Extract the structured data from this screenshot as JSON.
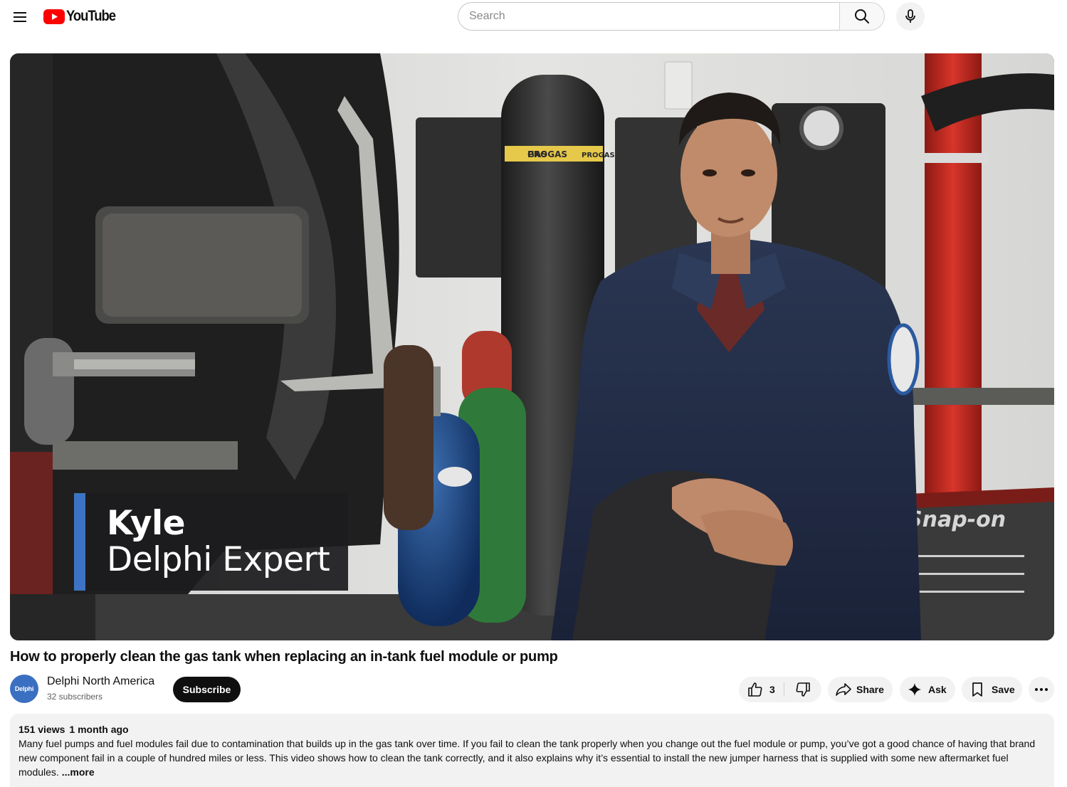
{
  "header": {
    "logo_text": "YouTube",
    "search_placeholder": "Search",
    "icons": [
      "menu-icon",
      "youtube-logo-icon",
      "search-icon",
      "microphone-icon"
    ]
  },
  "video": {
    "overlay_name": "Kyle",
    "overlay_role": "Delphi Expert",
    "scene_text": {
      "cylinder_label": "PROGAS",
      "cylinder_label_left": "GAS",
      "cylinder_label_right": "PROGAS",
      "machine_brand": "Snap-on"
    }
  },
  "title": "How to properly clean the gas tank when replacing an in-tank fuel module or pump",
  "channel": {
    "avatar_text": "Delphi",
    "name": "Delphi North America",
    "subscribers": "32 subscribers",
    "subscribe_label": "Subscribe"
  },
  "actions": {
    "like_count": "3",
    "share_label": "Share",
    "ask_label": "Ask",
    "save_label": "Save",
    "icons": [
      "thumbs-up-icon",
      "thumbs-down-icon",
      "share-icon",
      "sparkle-icon",
      "bookmark-icon",
      "more-horizontal-icon"
    ]
  },
  "description": {
    "views": "151 views",
    "date": "1 month ago",
    "text": "Many fuel pumps and fuel modules fail due to contamination that builds up in the gas tank over time. If you fail to clean the tank properly when you change out the fuel module or pump, you’ve got a good chance of having that brand new component fail in a couple of hundred miles or less. This video shows how to clean the tank correctly, and it also explains why it’s essential to install the new jumper harness that is supplied with some new aftermarket fuel modules.",
    "more_label": "...more"
  },
  "colors": {
    "brand_red": "#ff0000",
    "lower_third_accent": "#3d73c4",
    "avatar_bg": "#3b6fc1",
    "pill_bg": "#f2f2f2"
  }
}
